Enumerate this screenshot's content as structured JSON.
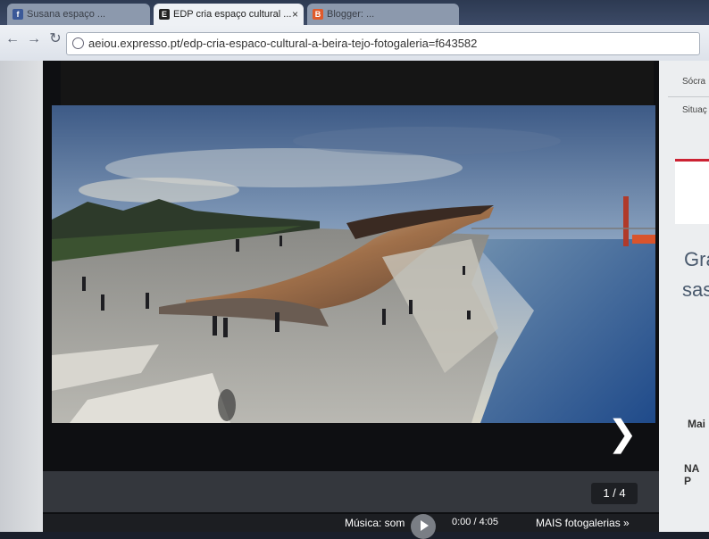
{
  "browser": {
    "tabs": [
      {
        "label": "Susana espaço ... ",
        "favicon": "f",
        "favicon_color": "#3b5998",
        "active": false
      },
      {
        "label": "EDP cria espaço cultural ...",
        "favicon": "E",
        "favicon_color": "#222222",
        "active": true,
        "close": "×"
      },
      {
        "label": "Blogger: ... ",
        "favicon": "B",
        "favicon_color": "#e05a2b",
        "active": false
      }
    ],
    "nav": {
      "back": "←",
      "forward": "→",
      "reload": "↻"
    },
    "url": "aeiou.expresso.pt/edp-cria-espaco-cultural-a-beira-tejo-fotogaleria=f643582"
  },
  "gallery": {
    "next_icon": "❯",
    "counter": "1 / 4",
    "music_label": "Música: som",
    "time": "0:00 / 4:05",
    "more_galleries": "MAIS fotogalerias »"
  },
  "right_sidebar": {
    "snippet1": "Sócra",
    "snippet2": "Situaç",
    "big_text1": "Gra",
    "big_text2": "sas!",
    "heading1": "Mai",
    "heading2": "NA P",
    "accent_color": "#cc2233"
  }
}
